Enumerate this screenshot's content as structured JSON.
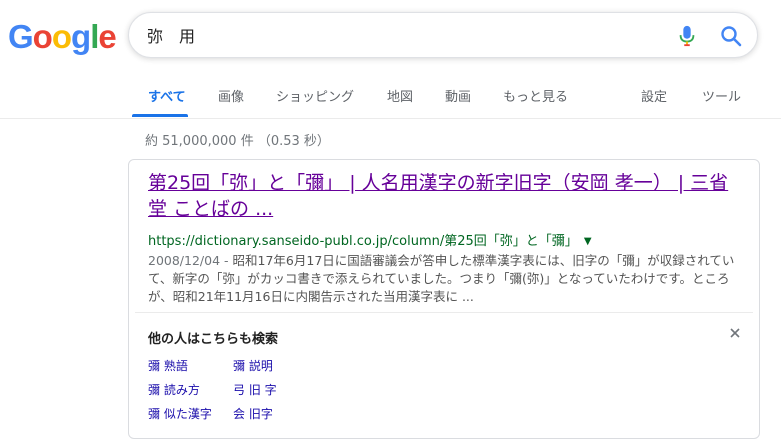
{
  "logo": {
    "letters": [
      "G",
      "o",
      "o",
      "g",
      "l",
      "e"
    ],
    "colors": [
      "#4285F4",
      "#EA4335",
      "#FBBC05",
      "#4285F4",
      "#34A853",
      "#EA4335"
    ]
  },
  "search": {
    "query": "弥　用",
    "mic_icon": "microphone-icon",
    "search_icon": "magnifier-icon"
  },
  "tabs": {
    "all": "すべて",
    "images": "画像",
    "shopping": "ショッピング",
    "maps": "地図",
    "videos": "動画",
    "more": "もっと見る",
    "settings": "設定",
    "tools": "ツール"
  },
  "stats": "約 51,000,000 件 （0.53 秒）",
  "result": {
    "title": "第25回「弥」と「彌」 | 人名用漢字の新字旧字（安岡 孝一） | 三省堂 ことばの ...",
    "url": "https://dictionary.sanseido-publ.co.jp/column/第25回「弥」と「彌」",
    "date": "2008/12/04 - ",
    "snippet": "昭和17年6月17日に国語審議会が答申した標準漢字表には、旧字の「彌」が収録されていて、新字の「弥」がカッコ書きで添えられていました。つまり「彌(弥)」となっていたわけです。ところが、昭和21年11月16日に内閣告示された当用漢字表に ..."
  },
  "related": {
    "title": "他の人はこちらも検索",
    "items": [
      "彌 熟語",
      "彌 説明",
      "彌 読み方",
      "弓 旧 字",
      "彌 似た漢字",
      "会 旧字"
    ],
    "close_icon": "close-icon"
  }
}
